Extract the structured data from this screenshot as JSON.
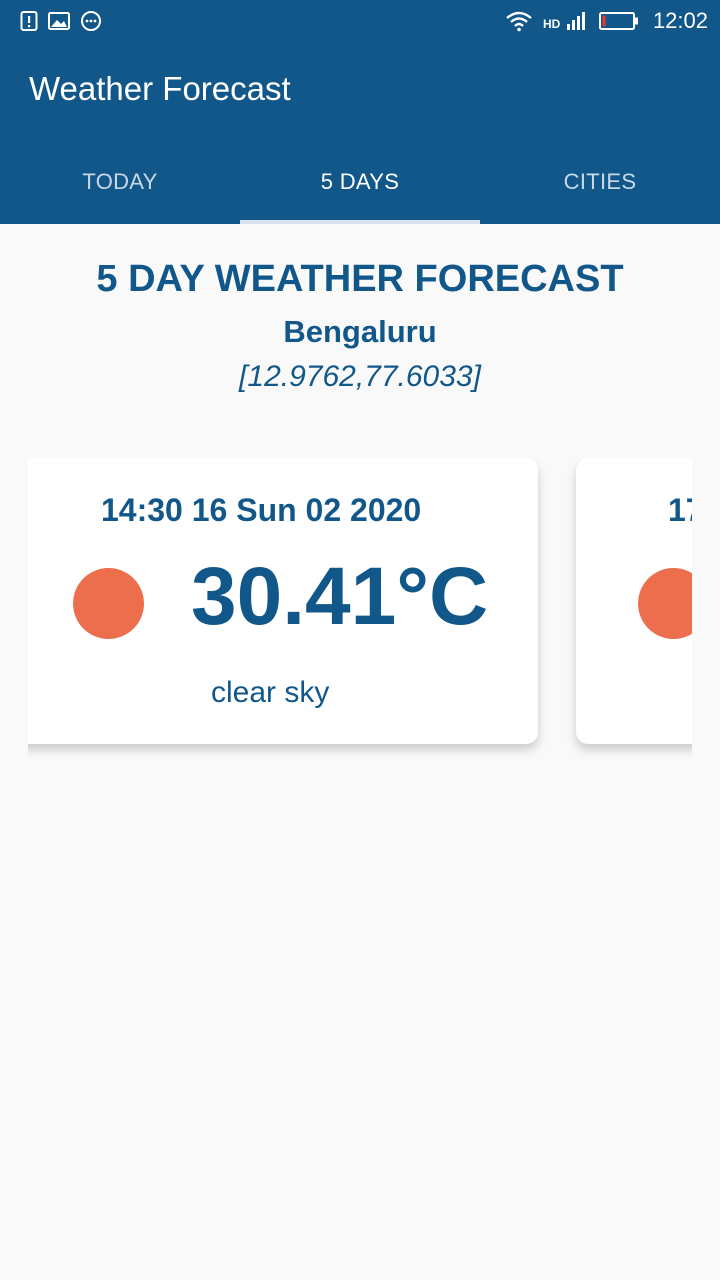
{
  "status_bar": {
    "time": "12:02",
    "left_icons": [
      "alert-icon",
      "image-icon",
      "message-icon"
    ],
    "right_icons": [
      "wifi-icon",
      "hd-signal-icon",
      "battery-icon"
    ]
  },
  "app": {
    "title": "Weather Forecast"
  },
  "tabs": [
    {
      "label": "TODAY",
      "active": false
    },
    {
      "label": "5 DAYS",
      "active": true
    },
    {
      "label": "CITIES",
      "active": false
    }
  ],
  "forecast": {
    "title": "5 DAY WEATHER FORECAST",
    "city": "Bengaluru",
    "coords": "[12.9762,77.6033]"
  },
  "cards": [
    {
      "datetime": "14:30 16 Sun 02 2020",
      "temp": "30.41°C",
      "description": "clear sky",
      "icon": "sun-icon"
    },
    {
      "datetime": "17",
      "temp": "",
      "description": "",
      "icon": "sun-icon"
    }
  ],
  "colors": {
    "primary": "#12578a",
    "sun": "#ec6e4c",
    "background": "#f9f9f9"
  }
}
